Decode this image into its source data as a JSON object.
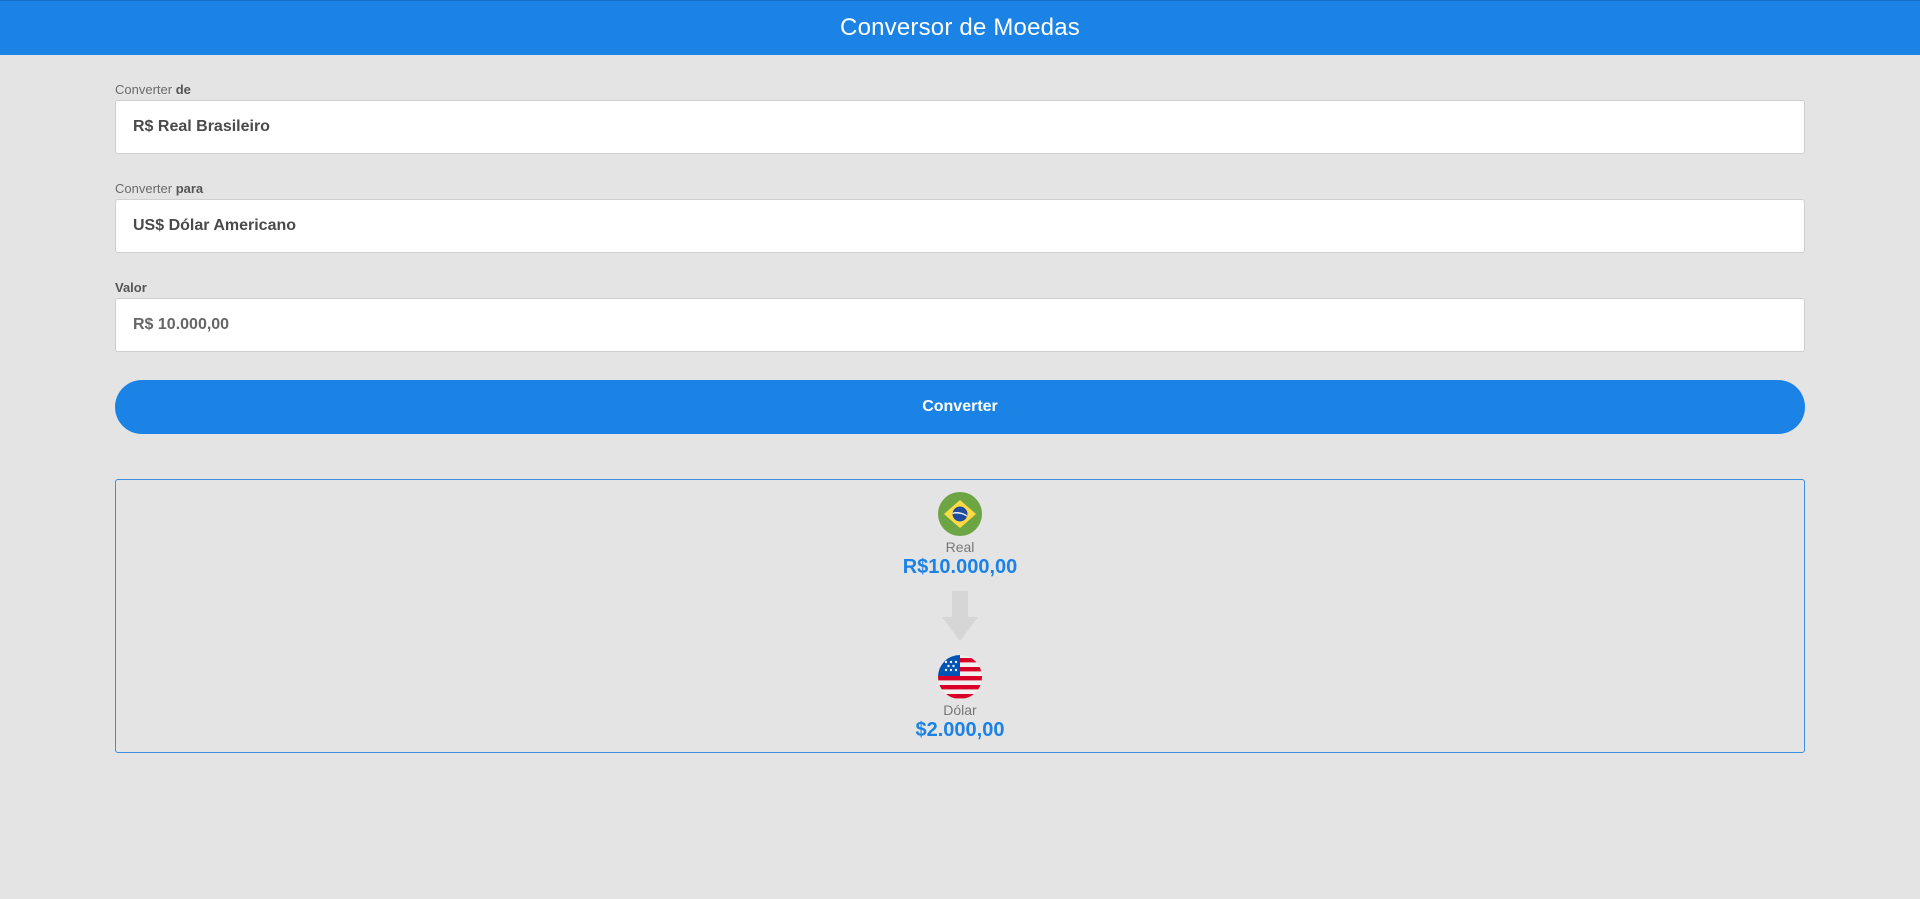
{
  "header": {
    "title": "Conversor de Moedas"
  },
  "form": {
    "from": {
      "label_prefix": "Converter",
      "label_emphasis": "de",
      "value": "R$ Real Brasileiro"
    },
    "to": {
      "label_prefix": "Converter",
      "label_emphasis": "para",
      "value": "US$ Dólar Americano"
    },
    "amount": {
      "label": "Valor",
      "value": "R$ 10.000,00"
    },
    "convert_button_label": "Converter"
  },
  "result": {
    "source": {
      "flag_icon": "brazil-flag-icon",
      "currency_name": "Real",
      "amount": "R$10.000,00"
    },
    "arrow_icon": "arrow-down-icon",
    "target": {
      "flag_icon": "usa-flag-icon",
      "currency_name": "Dólar",
      "amount": "$2.000,00"
    }
  },
  "colors": {
    "accent": "#1b83e5",
    "background": "#e4e4e4"
  }
}
